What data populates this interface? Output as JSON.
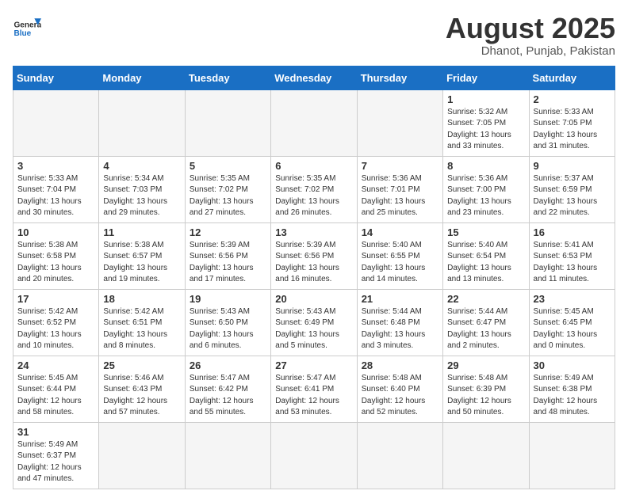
{
  "header": {
    "logo_general": "General",
    "logo_blue": "Blue",
    "title": "August 2025",
    "subtitle": "Dhanot, Punjab, Pakistan"
  },
  "weekdays": [
    "Sunday",
    "Monday",
    "Tuesday",
    "Wednesday",
    "Thursday",
    "Friday",
    "Saturday"
  ],
  "weeks": [
    [
      {
        "day": "",
        "info": ""
      },
      {
        "day": "",
        "info": ""
      },
      {
        "day": "",
        "info": ""
      },
      {
        "day": "",
        "info": ""
      },
      {
        "day": "",
        "info": ""
      },
      {
        "day": "1",
        "info": "Sunrise: 5:32 AM\nSunset: 7:05 PM\nDaylight: 13 hours and 33 minutes."
      },
      {
        "day": "2",
        "info": "Sunrise: 5:33 AM\nSunset: 7:05 PM\nDaylight: 13 hours and 31 minutes."
      }
    ],
    [
      {
        "day": "3",
        "info": "Sunrise: 5:33 AM\nSunset: 7:04 PM\nDaylight: 13 hours and 30 minutes."
      },
      {
        "day": "4",
        "info": "Sunrise: 5:34 AM\nSunset: 7:03 PM\nDaylight: 13 hours and 29 minutes."
      },
      {
        "day": "5",
        "info": "Sunrise: 5:35 AM\nSunset: 7:02 PM\nDaylight: 13 hours and 27 minutes."
      },
      {
        "day": "6",
        "info": "Sunrise: 5:35 AM\nSunset: 7:02 PM\nDaylight: 13 hours and 26 minutes."
      },
      {
        "day": "7",
        "info": "Sunrise: 5:36 AM\nSunset: 7:01 PM\nDaylight: 13 hours and 25 minutes."
      },
      {
        "day": "8",
        "info": "Sunrise: 5:36 AM\nSunset: 7:00 PM\nDaylight: 13 hours and 23 minutes."
      },
      {
        "day": "9",
        "info": "Sunrise: 5:37 AM\nSunset: 6:59 PM\nDaylight: 13 hours and 22 minutes."
      }
    ],
    [
      {
        "day": "10",
        "info": "Sunrise: 5:38 AM\nSunset: 6:58 PM\nDaylight: 13 hours and 20 minutes."
      },
      {
        "day": "11",
        "info": "Sunrise: 5:38 AM\nSunset: 6:57 PM\nDaylight: 13 hours and 19 minutes."
      },
      {
        "day": "12",
        "info": "Sunrise: 5:39 AM\nSunset: 6:56 PM\nDaylight: 13 hours and 17 minutes."
      },
      {
        "day": "13",
        "info": "Sunrise: 5:39 AM\nSunset: 6:56 PM\nDaylight: 13 hours and 16 minutes."
      },
      {
        "day": "14",
        "info": "Sunrise: 5:40 AM\nSunset: 6:55 PM\nDaylight: 13 hours and 14 minutes."
      },
      {
        "day": "15",
        "info": "Sunrise: 5:40 AM\nSunset: 6:54 PM\nDaylight: 13 hours and 13 minutes."
      },
      {
        "day": "16",
        "info": "Sunrise: 5:41 AM\nSunset: 6:53 PM\nDaylight: 13 hours and 11 minutes."
      }
    ],
    [
      {
        "day": "17",
        "info": "Sunrise: 5:42 AM\nSunset: 6:52 PM\nDaylight: 13 hours and 10 minutes."
      },
      {
        "day": "18",
        "info": "Sunrise: 5:42 AM\nSunset: 6:51 PM\nDaylight: 13 hours and 8 minutes."
      },
      {
        "day": "19",
        "info": "Sunrise: 5:43 AM\nSunset: 6:50 PM\nDaylight: 13 hours and 6 minutes."
      },
      {
        "day": "20",
        "info": "Sunrise: 5:43 AM\nSunset: 6:49 PM\nDaylight: 13 hours and 5 minutes."
      },
      {
        "day": "21",
        "info": "Sunrise: 5:44 AM\nSunset: 6:48 PM\nDaylight: 13 hours and 3 minutes."
      },
      {
        "day": "22",
        "info": "Sunrise: 5:44 AM\nSunset: 6:47 PM\nDaylight: 13 hours and 2 minutes."
      },
      {
        "day": "23",
        "info": "Sunrise: 5:45 AM\nSunset: 6:45 PM\nDaylight: 13 hours and 0 minutes."
      }
    ],
    [
      {
        "day": "24",
        "info": "Sunrise: 5:45 AM\nSunset: 6:44 PM\nDaylight: 12 hours and 58 minutes."
      },
      {
        "day": "25",
        "info": "Sunrise: 5:46 AM\nSunset: 6:43 PM\nDaylight: 12 hours and 57 minutes."
      },
      {
        "day": "26",
        "info": "Sunrise: 5:47 AM\nSunset: 6:42 PM\nDaylight: 12 hours and 55 minutes."
      },
      {
        "day": "27",
        "info": "Sunrise: 5:47 AM\nSunset: 6:41 PM\nDaylight: 12 hours and 53 minutes."
      },
      {
        "day": "28",
        "info": "Sunrise: 5:48 AM\nSunset: 6:40 PM\nDaylight: 12 hours and 52 minutes."
      },
      {
        "day": "29",
        "info": "Sunrise: 5:48 AM\nSunset: 6:39 PM\nDaylight: 12 hours and 50 minutes."
      },
      {
        "day": "30",
        "info": "Sunrise: 5:49 AM\nSunset: 6:38 PM\nDaylight: 12 hours and 48 minutes."
      }
    ],
    [
      {
        "day": "31",
        "info": "Sunrise: 5:49 AM\nSunset: 6:37 PM\nDaylight: 12 hours and 47 minutes."
      },
      {
        "day": "",
        "info": ""
      },
      {
        "day": "",
        "info": ""
      },
      {
        "day": "",
        "info": ""
      },
      {
        "day": "",
        "info": ""
      },
      {
        "day": "",
        "info": ""
      },
      {
        "day": "",
        "info": ""
      }
    ]
  ]
}
